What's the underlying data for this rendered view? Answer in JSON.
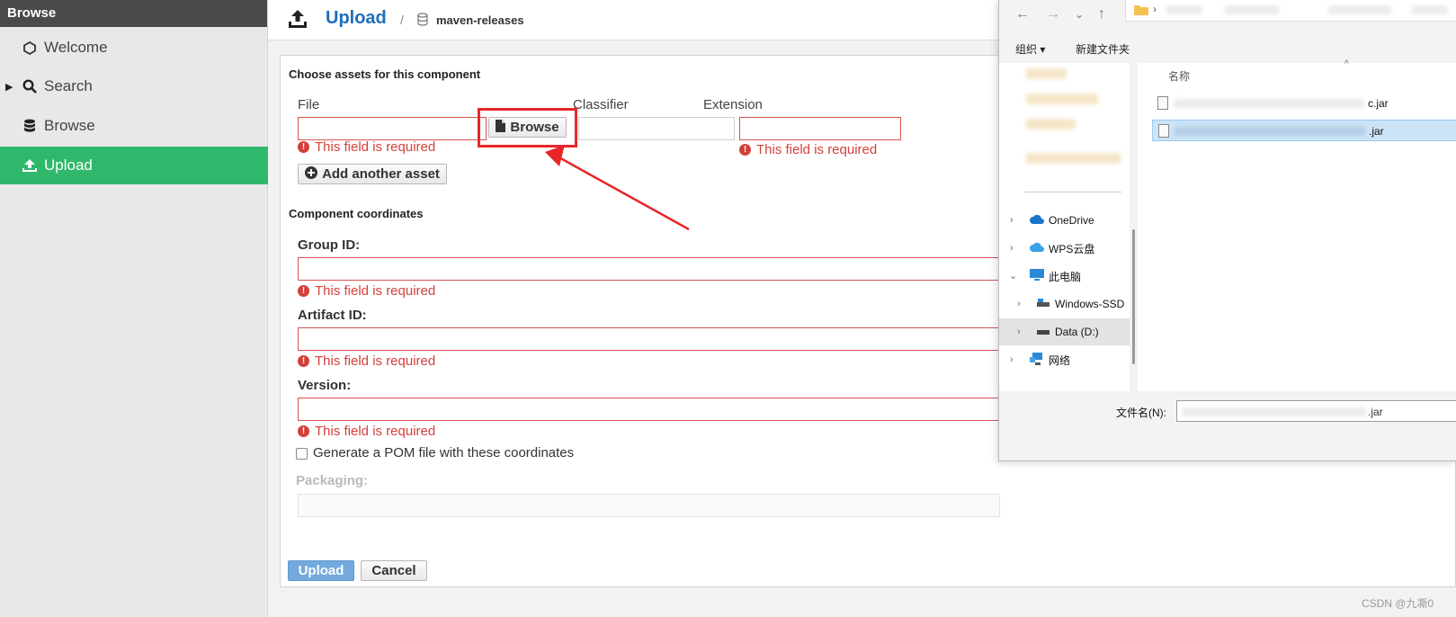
{
  "sidebar": {
    "header": "Browse",
    "items": [
      {
        "label": "Welcome"
      },
      {
        "label": "Search"
      },
      {
        "label": "Browse"
      },
      {
        "label": "Upload"
      }
    ]
  },
  "header": {
    "title": "Upload",
    "separator": "/",
    "repository": "maven-releases"
  },
  "form": {
    "assets_title": "Choose assets for this component",
    "col_file": "File",
    "col_classifier": "Classifier",
    "col_extension": "Extension",
    "browse_label": "Browse",
    "required_error": "This field is required",
    "add_asset_label": "Add another asset",
    "coords_title": "Component coordinates",
    "group_id_label": "Group ID:",
    "artifact_id_label": "Artifact ID:",
    "version_label": "Version:",
    "pom_label": "Generate a POM file with these coordinates",
    "packaging_label": "Packaging:",
    "upload_label": "Upload",
    "cancel_label": "Cancel"
  },
  "dialog": {
    "toolbar_organize": "组织 ▾",
    "toolbar_new_folder": "新建文件夹",
    "column_name": "名称",
    "nav": [
      {
        "label": "OneDrive"
      },
      {
        "label": "WPS云盘"
      },
      {
        "label": "此电脑"
      },
      {
        "label": "Windows-SSD"
      },
      {
        "label": "Data (D:)"
      },
      {
        "label": "网络"
      }
    ],
    "files": [
      {
        "name": "c.jar"
      },
      {
        "name": ".jar"
      }
    ],
    "filename_label": "文件名(N):",
    "filename_value": ".jar"
  },
  "watermark": "CSDN @九凘0",
  "colors": {
    "accent_green": "#2fb86b",
    "title_blue": "#1d6fb8",
    "error_red": "#d43f3a",
    "highlight_red": "#e8262a"
  }
}
